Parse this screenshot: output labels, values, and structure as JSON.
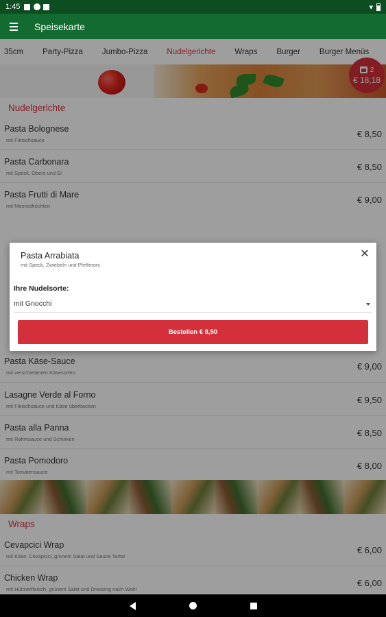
{
  "status_bar": {
    "time": "1:45"
  },
  "app_bar": {
    "title": "Speisekarte"
  },
  "tabs": [
    {
      "label": "35cm",
      "active": false
    },
    {
      "label": "Party-Pizza",
      "active": false
    },
    {
      "label": "Jumbo-Pizza",
      "active": false
    },
    {
      "label": "Nudelgerichte",
      "active": true
    },
    {
      "label": "Wraps",
      "active": false
    },
    {
      "label": "Burger",
      "active": false
    },
    {
      "label": "Burger Menüs",
      "active": false
    }
  ],
  "cart": {
    "count": "2",
    "total": "€ 18,18"
  },
  "sections": {
    "nudelgerichte": "Nudelgerichte",
    "wraps": "Wraps"
  },
  "items": [
    {
      "name": "Pasta Bolognese",
      "desc": "mit Fleischsauce",
      "price": "€ 8,50"
    },
    {
      "name": "Pasta Carbonara",
      "desc": "mit Speck, Obers und Ei",
      "price": "€ 8,50"
    },
    {
      "name": "Pasta Frutti di Mare",
      "desc": "mit Meeresfrüchten",
      "price": "€ 9,00"
    },
    {
      "name": "Pasta Käse-Sauce",
      "desc": "mit verschiedenen Käsesorten",
      "price": "€ 9,00"
    },
    {
      "name": "Lasagne Verde al Forno",
      "desc": "mit Fleischsauce und Käse überbacken",
      "price": "€ 9,50"
    },
    {
      "name": "Pasta alla Panna",
      "desc": "mit Rahmsauce und Schinken",
      "price": "€ 8,50"
    },
    {
      "name": "Pasta Pomodoro",
      "desc": "mit Tomatensauce",
      "price": "€ 8,00"
    },
    {
      "name": "Cevapcici Wrap",
      "desc": "mit Käse, Cevapcici, grünem Salat und Sauce Tartar",
      "price": "€ 6,00"
    },
    {
      "name": "Chicken Wrap",
      "desc": "mit Hühnerfleisch, grünem Salat und Dressing nach Wahl",
      "price": "€ 6,00"
    }
  ],
  "dialog": {
    "title": "Pasta Arrabiata",
    "subtitle": "mit Speck, Zwiebeln und Pfefferoni",
    "close_icon": "close-icon",
    "select_label": "Ihre Nudelsorte:",
    "select_value": "mit Gnocchi",
    "order_button": "Bestellen € 8,50"
  },
  "colors": {
    "primary": "#146b31",
    "status": "#0d4d22",
    "accent": "#d3303b"
  }
}
